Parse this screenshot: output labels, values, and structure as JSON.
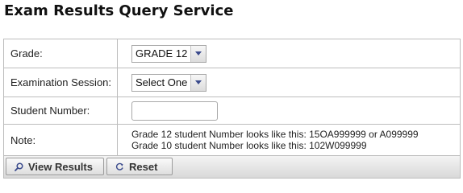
{
  "page": {
    "title": "Exam Results Query Service"
  },
  "form": {
    "grade": {
      "label": "Grade:",
      "selected": "GRADE 12"
    },
    "session": {
      "label": "Examination Session:",
      "selected": "Select One"
    },
    "student_number": {
      "label": "Student Number:",
      "value": "",
      "placeholder": ""
    },
    "note": {
      "label": "Note:",
      "lines": [
        "Grade 12 student Number looks like this: 15OA999999 or A099999",
        "Grade 10 student Number looks like this: 102W099999"
      ]
    }
  },
  "buttons": {
    "view": {
      "label": "View Results",
      "icon": "search-icon"
    },
    "reset": {
      "label": "Reset",
      "icon": "refresh-icon"
    }
  },
  "colors": {
    "border": "#bdbdbd",
    "button_bar": "#d9d9d9",
    "icon_blue": "#3a4a8c"
  }
}
